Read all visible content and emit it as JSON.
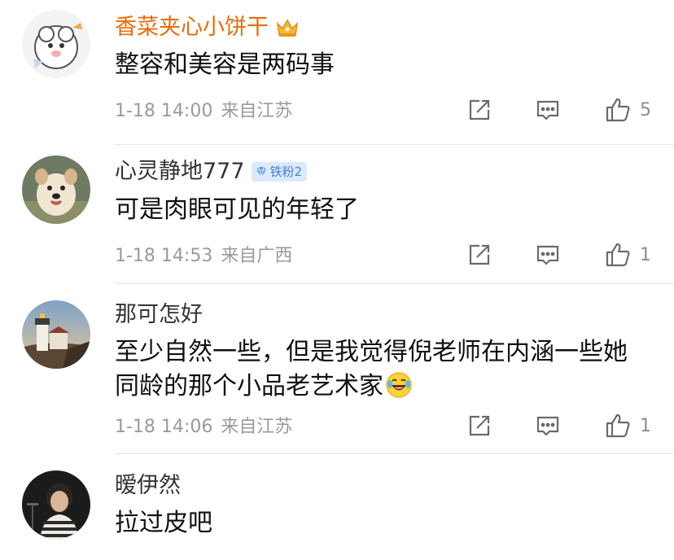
{
  "comments": [
    {
      "username": "香菜夹心小饼干",
      "content_lines": [
        "整容和美容是两码事"
      ],
      "date": "1-18 14:00",
      "location": "来自江苏",
      "likes": "5",
      "badge_icon": "crown-icon"
    },
    {
      "username": "心灵静地777",
      "badge_text": "铁粉2",
      "content_lines": [
        "可是肉眼可见的年轻了"
      ],
      "date": "1-18 14:53",
      "location": "来自广西",
      "likes": "1"
    },
    {
      "username": "那可怎好",
      "content_lines": [
        "至少自然一些，但是我觉得倪老师在内涵一些她",
        "同龄的那个小品老艺术家"
      ],
      "emoji_icon": "laugh-cry-emoji",
      "date": "1-18 14:06",
      "location": "来自江苏",
      "likes": "1"
    },
    {
      "username": "暧伊然",
      "content_lines": [
        "拉过皮吧"
      ]
    }
  ],
  "colors": {
    "vip_username": "#e86b0c",
    "username": "#333333",
    "content": "#111111",
    "meta": "#9a9a9a",
    "badge_bg": "#dce9fb",
    "badge_text": "#4a7fd0"
  },
  "icons": [
    "forward-icon",
    "comment-icon",
    "like-icon"
  ]
}
